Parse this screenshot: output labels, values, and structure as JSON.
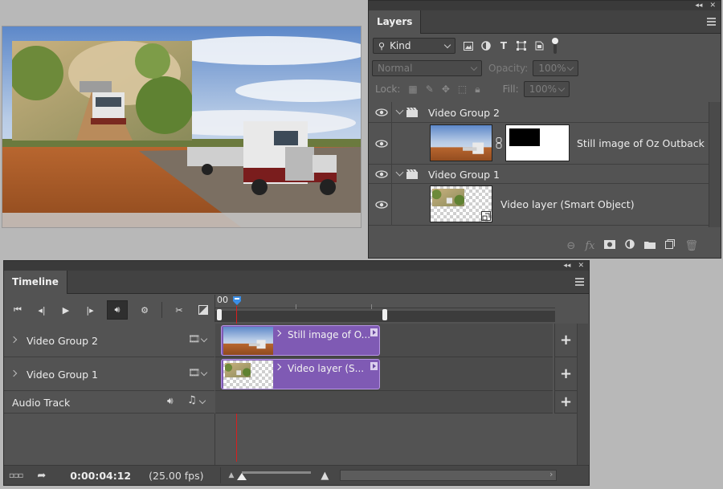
{
  "layers": {
    "tab_label": "Layers",
    "kind_label": "Kind",
    "blend_mode": "Normal",
    "opacity_label": "Opacity:",
    "opacity_value": "100%",
    "lock_label": "Lock:",
    "fill_label": "Fill:",
    "fill_value": "100%",
    "items": [
      {
        "name": "Video Group 2",
        "type": "group"
      },
      {
        "name": "Still image of Oz Outback",
        "type": "layer"
      },
      {
        "name": "Video Group 1",
        "type": "group"
      },
      {
        "name": "Video layer (Smart Object)",
        "type": "layer"
      }
    ]
  },
  "timeline": {
    "tab_label": "Timeline",
    "ruler_start": "00",
    "tracks": [
      {
        "name": "Video Group 2",
        "clip_label": "Still image of O..."
      },
      {
        "name": "Video Group 1",
        "clip_label": "Video layer (S..."
      },
      {
        "name": "Audio Track"
      }
    ],
    "timecode": "0:00:04:12",
    "fps": "(25.00 fps)"
  },
  "colors": {
    "clip_purple": "#7f5ab4",
    "playhead_red": "#d81e1e",
    "playhead_blue": "#3a8ee6",
    "panel_bg": "#535353"
  }
}
